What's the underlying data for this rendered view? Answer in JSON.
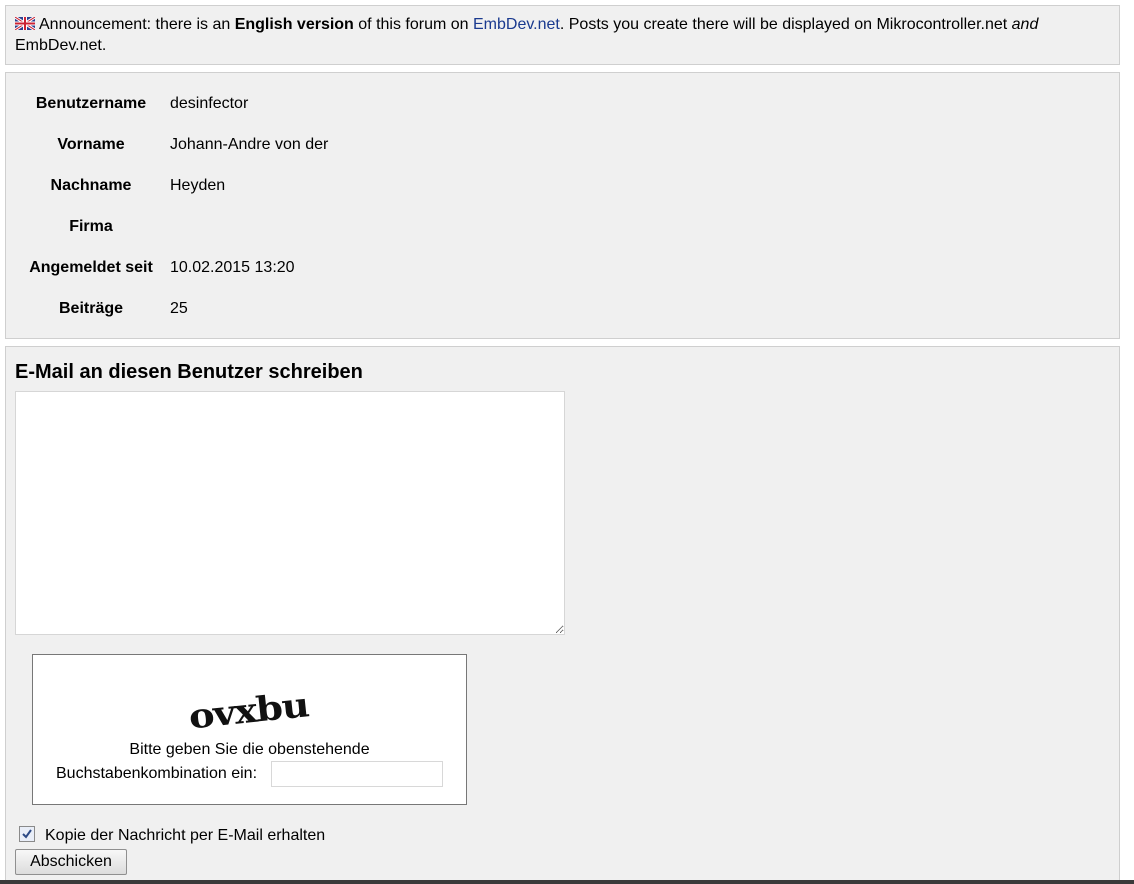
{
  "announcement": {
    "icon": "uk-flag-icon",
    "prefix": "Announcement: there is an ",
    "bold": "English version",
    "middle": " of this forum on ",
    "link_text": "EmbDev.net",
    "suffix": ". Posts you create there will be displayed on Mikrocontroller.net ",
    "italic": "and",
    "suffix2": " EmbDev.net."
  },
  "profile": {
    "rows": [
      {
        "label": "Benutzername",
        "value": "desinfector"
      },
      {
        "label": "Vorname",
        "value": "Johann-Andre von der"
      },
      {
        "label": "Nachname",
        "value": "Heyden"
      },
      {
        "label": "Firma",
        "value": ""
      },
      {
        "label": "Angemeldet seit",
        "value": "10.02.2015 13:20"
      },
      {
        "label": "Beiträge",
        "value": "25"
      }
    ]
  },
  "mail": {
    "heading": "E-Mail an diesen Benutzer schreiben",
    "message_value": "",
    "captcha_text": "ovxbu",
    "captcha_hint_1": "Bitte geben Sie die obenstehende",
    "captcha_hint_2": "Buchstabenkombination ein:",
    "captcha_value": "",
    "copy_label": "Kopie der Nachricht per E-Mail erhalten",
    "copy_checked": true,
    "submit_label": "Abschicken"
  }
}
